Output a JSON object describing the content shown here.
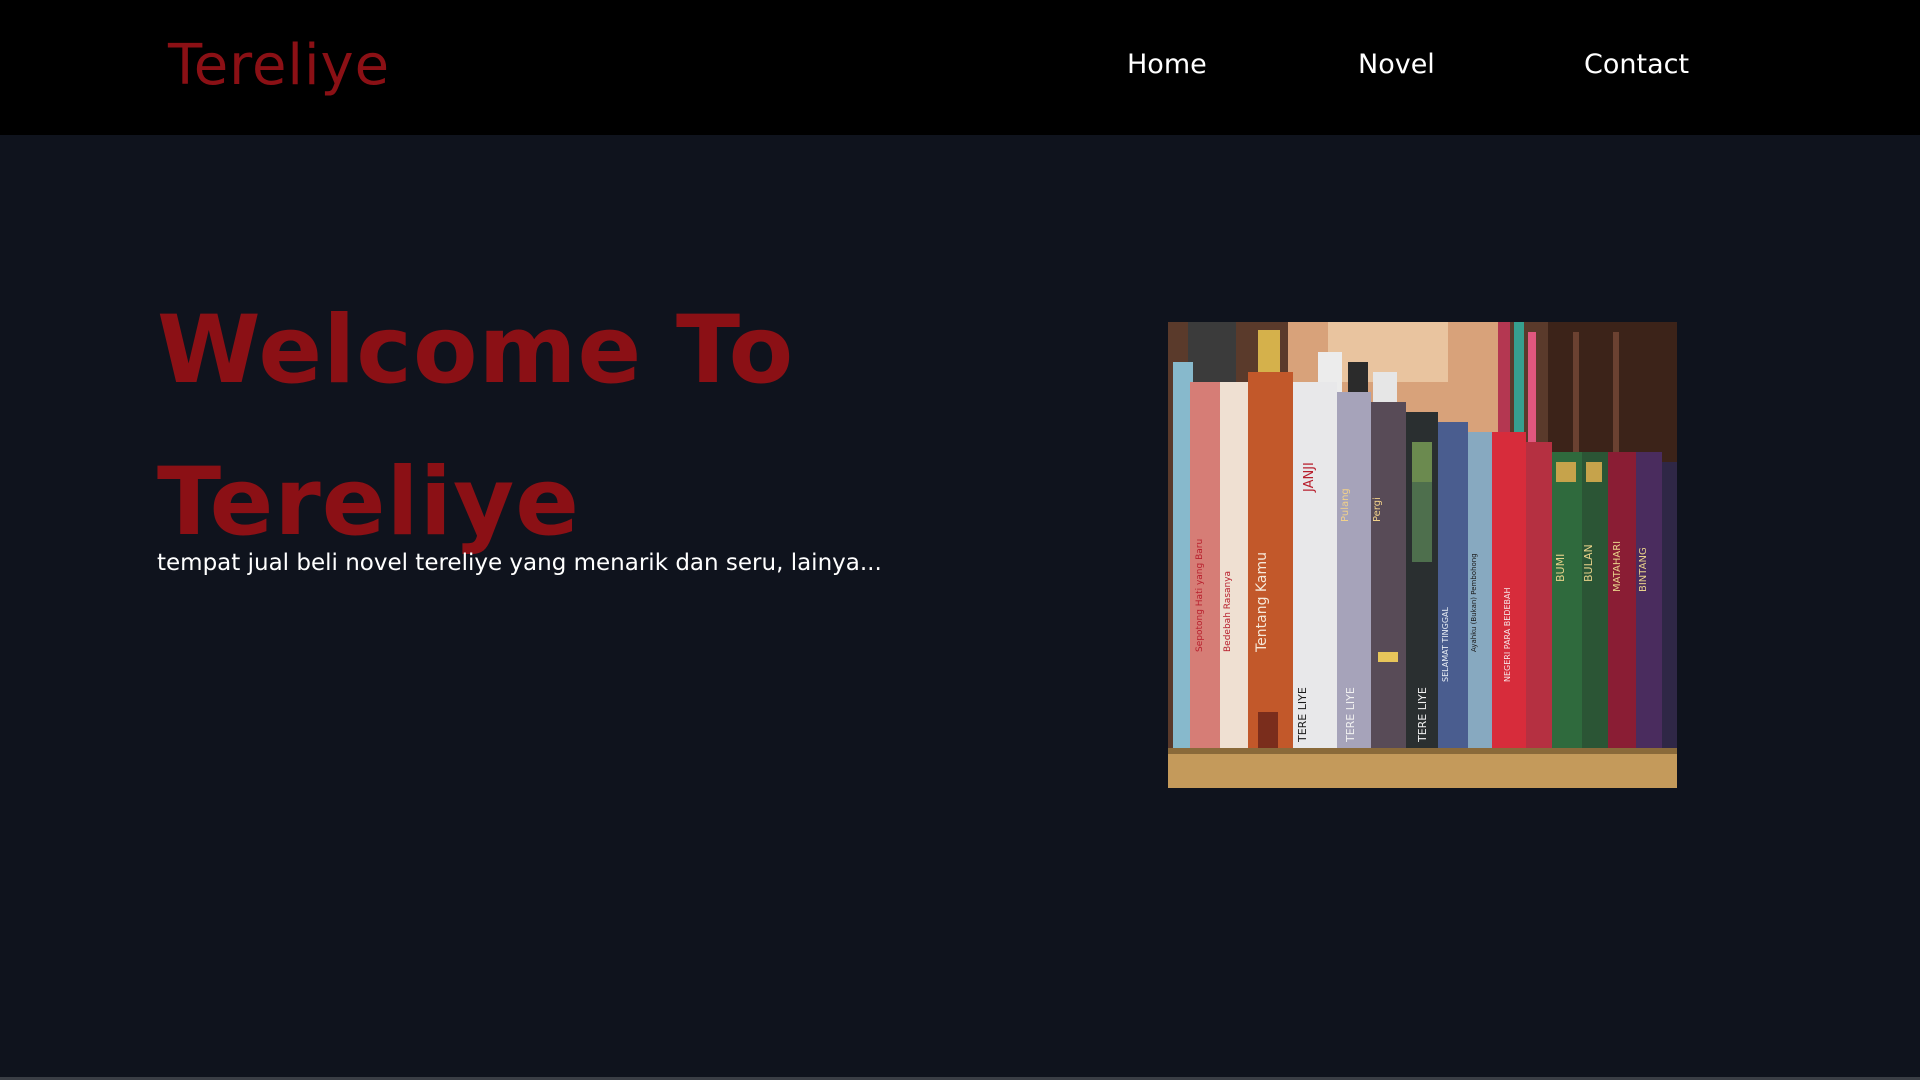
{
  "header": {
    "brand": "Tereliye",
    "nav": [
      {
        "label": "Home"
      },
      {
        "label": "Novel"
      },
      {
        "label": "Contact"
      }
    ]
  },
  "hero": {
    "title": "Welcome To Tereliye",
    "subtitle": "tempat jual beli novel tereliye yang menarik dan seru, lainya...",
    "image": {
      "spine_texts": [
        "TERE LIYE",
        "TERE LIYE",
        "TERE LIYE",
        "Tentang Kamu",
        "JANJI",
        "BUMI",
        "BULAN",
        "MATAHARI",
        "BINTANG",
        "SELAMAT TINGGAL",
        "NEGERI PARA BEDEBAH",
        "Bedebah Rasanya",
        "Sepotong Hati yang Baru",
        "Ayahku (Bukan) Pembohong",
        "Pulang",
        "Pergi"
      ]
    }
  },
  "colors": {
    "brand_red": "#8b1015",
    "header_bg": "#000000",
    "page_bg": "#0f131d",
    "nav_text": "#ffffff"
  }
}
